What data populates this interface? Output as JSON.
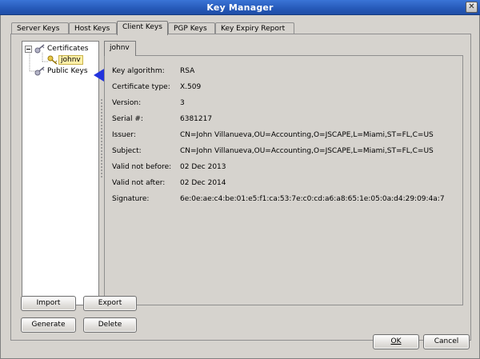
{
  "window": {
    "title": "Key Manager",
    "close_glyph": "✕"
  },
  "tabs": [
    {
      "label": "Server Keys"
    },
    {
      "label": "Host Keys"
    },
    {
      "label": "Client Keys"
    },
    {
      "label": "PGP Keys"
    },
    {
      "label": "Key Expiry Report"
    }
  ],
  "active_tab": "Client Keys",
  "tree": {
    "items": [
      {
        "label": "Certificates",
        "icon": "key-icon"
      },
      {
        "label": "johnv",
        "icon": "key-icon",
        "selected": true
      },
      {
        "label": "Public Keys",
        "icon": "key-icon"
      }
    ]
  },
  "detail": {
    "tab_label": "johnv",
    "fields": [
      {
        "label": "Key algorithm:",
        "value": "RSA"
      },
      {
        "label": "Certificate type:",
        "value": "X.509"
      },
      {
        "label": "Version:",
        "value": "3"
      },
      {
        "label": "Serial #:",
        "value": "6381217"
      },
      {
        "label": "Issuer:",
        "value": "CN=John Villanueva,OU=Accounting,O=JSCAPE,L=Miami,ST=FL,C=US"
      },
      {
        "label": "Subject:",
        "value": "CN=John Villanueva,OU=Accounting,O=JSCAPE,L=Miami,ST=FL,C=US"
      },
      {
        "label": "Valid not before:",
        "value": "02 Dec 2013"
      },
      {
        "label": "Valid not after:",
        "value": "02 Dec 2014"
      },
      {
        "label": "Signature:",
        "value": "6e:0e:ae:c4:be:01:e5:f1:ca:53:7e:c0:cd:a6:a8:65:1e:05:0a:d4:29:09:4a:7"
      }
    ]
  },
  "buttons": {
    "import": "Import",
    "export": "Export",
    "generate": "Generate",
    "delete": "Delete"
  },
  "footer": {
    "ok": "OK",
    "cancel": "Cancel"
  },
  "colors": {
    "titlebar": "#2659b8",
    "selection_highlight": "#fff0a8",
    "arrow": "#2233dd"
  }
}
